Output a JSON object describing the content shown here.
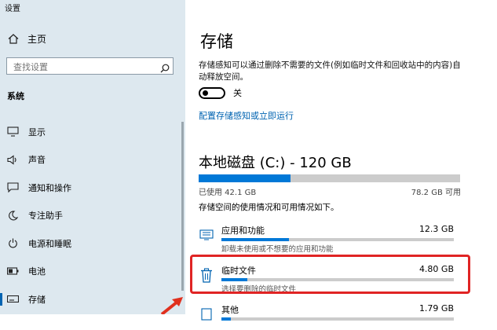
{
  "window": {
    "title": "设置"
  },
  "sidebar": {
    "home_label": "主页",
    "search_placeholder": "查找设置",
    "section": "系统",
    "items": [
      {
        "label": "显示",
        "icon": "display-icon"
      },
      {
        "label": "声音",
        "icon": "speaker-icon"
      },
      {
        "label": "通知和操作",
        "icon": "notification-icon"
      },
      {
        "label": "专注助手",
        "icon": "moon-icon"
      },
      {
        "label": "电源和睡眠",
        "icon": "power-icon"
      },
      {
        "label": "电池",
        "icon": "battery-icon"
      },
      {
        "label": "存储",
        "icon": "storage-icon",
        "active": true
      }
    ]
  },
  "main": {
    "title": "存储",
    "description": "存储感知可以通过删除不需要的文件(例如临时文件和回收站中的内容)自动释放空间。",
    "toggle_label": "关",
    "toggle_state": "off",
    "configure_link": "配置存储感知或立即运行",
    "disk": {
      "title": "本地磁盘 (C:) - 120 GB",
      "used": "已使用 42.1 GB",
      "available": "78.2 GB 可用",
      "used_fraction": 0.35
    },
    "usage_description": "存储空间的使用情况和可用情况如下。",
    "categories": [
      {
        "name": "应用和功能",
        "size": "12.3 GB",
        "desc": "卸载未使用或不想要的应用和功能",
        "fraction": 0.29,
        "icon": "apps-icon"
      },
      {
        "name": "临时文件",
        "size": "4.80 GB",
        "desc": "选择要删除的临时文件",
        "fraction": 0.11,
        "icon": "trash-icon",
        "highlighted": true
      },
      {
        "name": "其他",
        "size": "1.79 GB",
        "desc": "",
        "fraction": 0.04,
        "icon": "other-icon"
      }
    ]
  },
  "colors": {
    "accent": "#0078d7",
    "highlight": "#e02424",
    "sidebar_bg": "#dde8ef"
  }
}
